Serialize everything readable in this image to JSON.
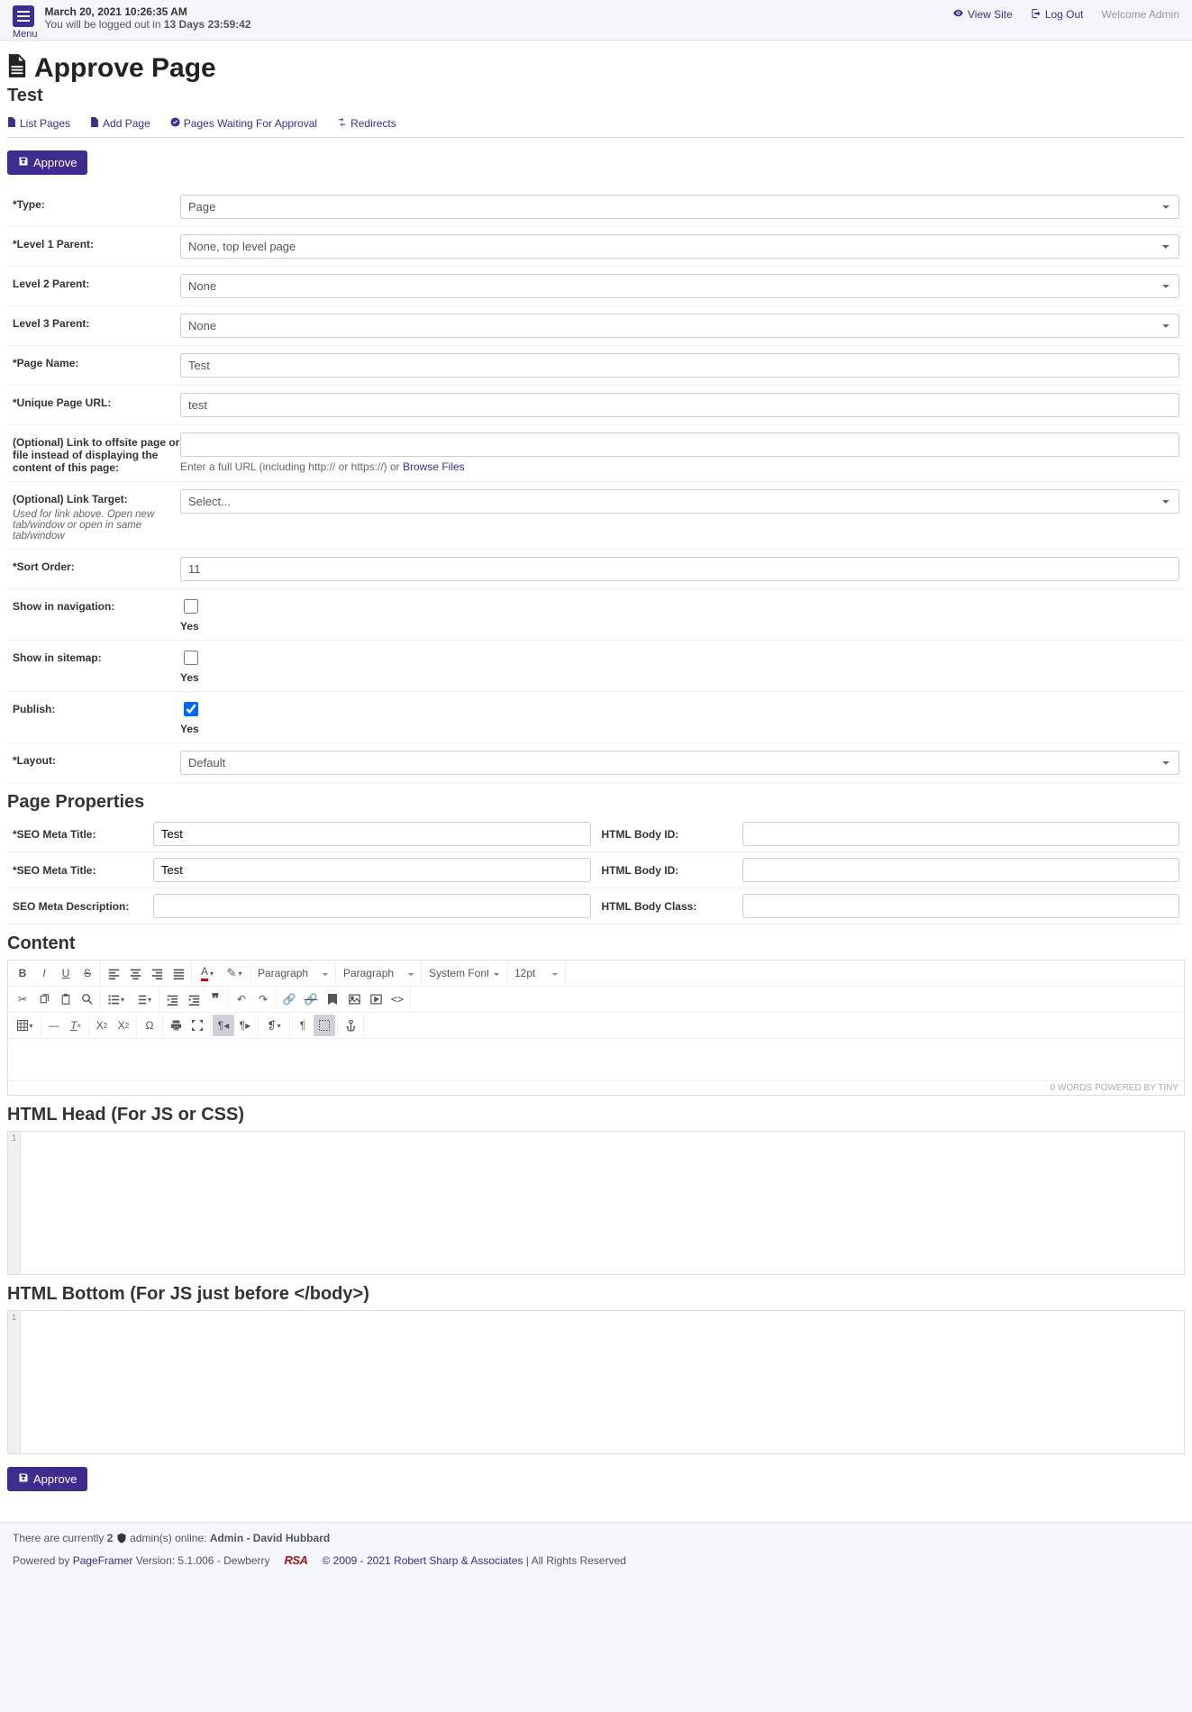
{
  "header": {
    "menu_label": "Menu",
    "datetime": "March 20, 2021 10:26:35 AM",
    "logout_prefix": "You will be logged out in ",
    "logout_countdown": "13 Days 23:59:42",
    "view_site": "View Site",
    "log_out": "Log Out",
    "welcome": "Welcome Admin"
  },
  "page": {
    "title": "Approve Page",
    "subtitle": "Test"
  },
  "tabs": {
    "list_pages": "List Pages",
    "add_page": "Add Page",
    "pages_waiting": "Pages Waiting For Approval",
    "redirects": "Redirects"
  },
  "buttons": {
    "approve": "Approve"
  },
  "form": {
    "type_label": "*Type:",
    "type_value": "Page",
    "l1_label": "*Level 1 Parent:",
    "l1_value": "None, top level page",
    "l2_label": "Level 2 Parent:",
    "l2_value": "None",
    "l3_label": "Level 3 Parent:",
    "l3_value": "None",
    "pagename_label": "*Page Name:",
    "pagename_value": "Test",
    "url_label": "*Unique Page URL:",
    "url_value": "test",
    "offsite_label": "(Optional) Link to offsite page or file instead of displaying the content of this page:",
    "offsite_value": "",
    "offsite_helper_prefix": "Enter a full URL (including http:// or https://) or ",
    "offsite_helper_link": "Browse Files",
    "linktarget_label": "(Optional) Link Target:",
    "linktarget_sub": "Used for link above. Open new tab/window or open in same tab/window",
    "linktarget_value": "Select...",
    "sortorder_label": "*Sort Order:",
    "sortorder_value": "11",
    "shownav_label": "Show in navigation:",
    "showsitemap_label": "Show in sitemap:",
    "publish_label": "Publish:",
    "yes": "Yes",
    "layout_label": "*Layout:",
    "layout_value": "Default"
  },
  "sections": {
    "page_properties": "Page Properties",
    "content": "Content",
    "html_head": "HTML Head (For JS or CSS)",
    "html_bottom": "HTML Bottom (For JS just before </body>)"
  },
  "props": {
    "seo_title_label": "*SEO Meta Title:",
    "seo_title_value": "Test",
    "body_id_label": "HTML Body ID:",
    "body_id_value": "",
    "seo_title2_label": "*SEO Meta Title:",
    "seo_title2_value": "Test",
    "body_id2_label": "HTML Body ID:",
    "body_id2_value": "",
    "seo_desc_label": "SEO Meta Description:",
    "seo_desc_value": "",
    "body_class_label": "HTML Body Class:",
    "body_class_value": ""
  },
  "editor": {
    "paragraph1": "Paragraph",
    "paragraph2": "Paragraph",
    "font": "System Font",
    "size": "12pt",
    "status": "0 WORDS   POWERED BY TINY"
  },
  "code": {
    "line1": "1"
  },
  "footer": {
    "admins_prefix": "There are currently ",
    "admins_count": "2",
    "admins_mid": " admin(s) online: ",
    "admins_list": "Admin - David Hubbard",
    "powered_by": "Powered by ",
    "pageframer": "PageFramer",
    "version": " Version: 5.1.006 - Dewberry",
    "rsa": "RSA",
    "copyright_link": "© 2009 - 2021 Robert Sharp & Associates",
    "rights": " | All Rights Reserved"
  }
}
